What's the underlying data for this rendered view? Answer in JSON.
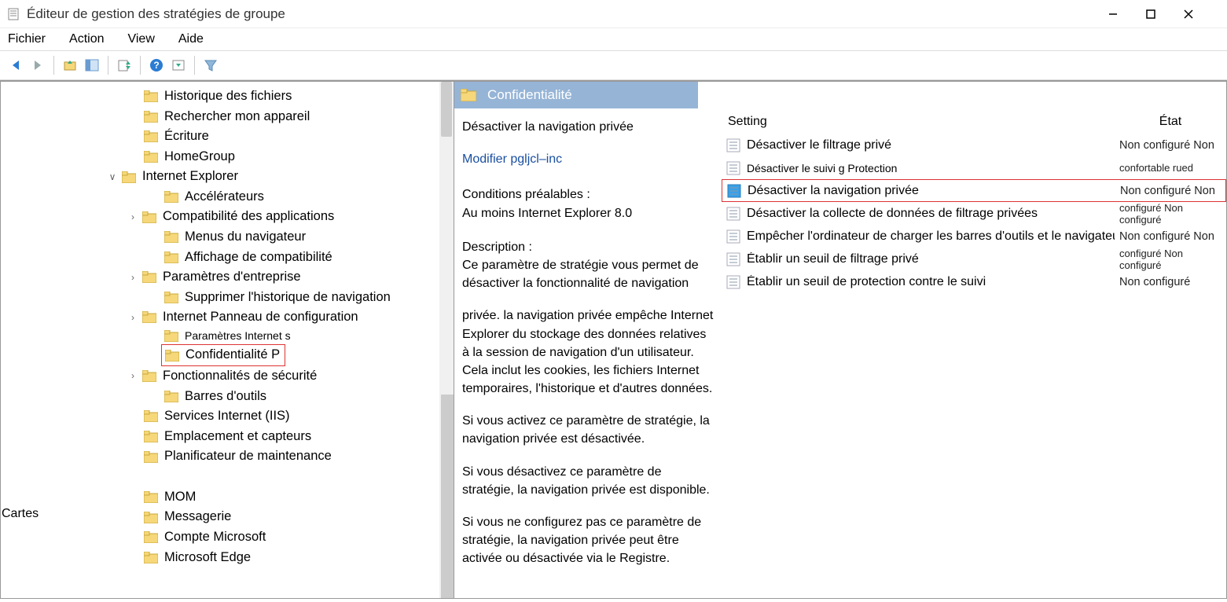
{
  "window": {
    "title": "Éditeur de gestion des stratégies de groupe"
  },
  "menubar": [
    "Fichier",
    "Action",
    "View",
    "Aide"
  ],
  "orphan_label": "Cartes",
  "tree": [
    {
      "indent": 3,
      "exp": "",
      "label": "Historique des fichiers"
    },
    {
      "indent": 3,
      "exp": "",
      "label": "Rechercher mon appareil"
    },
    {
      "indent": 3,
      "exp": "",
      "label": "Écriture"
    },
    {
      "indent": 3,
      "exp": "",
      "label": "HomeGroup"
    },
    {
      "indent": 2,
      "exp": "v",
      "label": "Internet Explorer"
    },
    {
      "indent": 4,
      "exp": "",
      "label": "Accélérateurs"
    },
    {
      "indent": 3,
      "exp": ">",
      "label": "Compatibilité des applications"
    },
    {
      "indent": 4,
      "exp": "",
      "label": "Menus du navigateur"
    },
    {
      "indent": 4,
      "exp": "",
      "label": "Affichage de compatibilité"
    },
    {
      "indent": 3,
      "exp": ">",
      "label": "Paramètres d'entreprise"
    },
    {
      "indent": 4,
      "exp": "",
      "label": "Supprimer l'historique de navigation"
    },
    {
      "indent": 3,
      "exp": ">",
      "label": "Internet Panneau de configuration"
    },
    {
      "indent": 4,
      "exp": "",
      "label": "Paramètres Internet s",
      "small": true
    },
    {
      "indent": 4,
      "exp": "",
      "label": "Confidentialité P",
      "boxed": true
    },
    {
      "indent": 3,
      "exp": ">",
      "label": "Fonctionnalités de sécurité"
    },
    {
      "indent": 4,
      "exp": "",
      "label": "Barres d'outils"
    },
    {
      "indent": 3,
      "exp": "",
      "label": "Services Internet (IIS)"
    },
    {
      "indent": 3,
      "exp": "",
      "label": "Emplacement et capteurs"
    },
    {
      "indent": 3,
      "exp": "",
      "label": "Planificateur de maintenance"
    },
    {
      "indent": 3,
      "exp": "",
      "label": "MOM"
    },
    {
      "indent": 3,
      "exp": "",
      "label": "Messagerie"
    },
    {
      "indent": 3,
      "exp": "",
      "label": "Compte Microsoft"
    },
    {
      "indent": 3,
      "exp": "",
      "label": "Microsoft Edge"
    }
  ],
  "category": "Confidentialité",
  "selected_policy": {
    "name": "Désactiver la navigation privée",
    "edit_link": "Modifier pgljcl–inc",
    "prereq_label": "Conditions préalables :",
    "prereq_value": "Au moins Internet Explorer 8.0",
    "desc_label": "Description :",
    "desc_p1": "Ce paramètre de stratégie vous permet de désactiver la fonctionnalité de navigation",
    "desc_p2": "privée. la navigation privée empêche Internet Explorer du stockage des données relatives à la session de navigation d'un utilisateur. Cela inclut les cookies, les fichiers Internet temporaires, l'historique et d'autres données.",
    "desc_p3": "Si vous activez ce paramètre de stratégie, la navigation privée est désactivée.",
    "desc_p4": "Si vous désactivez ce paramètre de stratégie, la navigation privée est disponible.",
    "desc_p5": "Si vous ne configurez pas ce paramètre de stratégie, la navigation privée peut être activée ou désactivée via le Registre."
  },
  "columns": {
    "setting": "Setting",
    "state": "État"
  },
  "settings": [
    {
      "label": "Désactiver le filtrage privé",
      "state": "Non configuré Non",
      "hl": false
    },
    {
      "label": "Désactiver le suivi    g Protection",
      "state": "confortable rued",
      "hl": false,
      "small": true
    },
    {
      "label": "Désactiver la navigation privée",
      "state": "Non configuré Non",
      "hl": true
    },
    {
      "label": "Désactiver la collecte de données de filtrage privées",
      "state": "configuré Non configuré",
      "hl": false
    },
    {
      "label": "Empêcher l'ordinateur de charger les barres d'outils et le navigateur",
      "state": "Non configuré Non",
      "hl": false
    },
    {
      "label": "Établir un seuil de filtrage privé",
      "state": "configuré Non configuré",
      "hl": false
    },
    {
      "label": "Établir un seuil de protection contre le suivi",
      "state": "Non configuré",
      "hl": false
    }
  ]
}
